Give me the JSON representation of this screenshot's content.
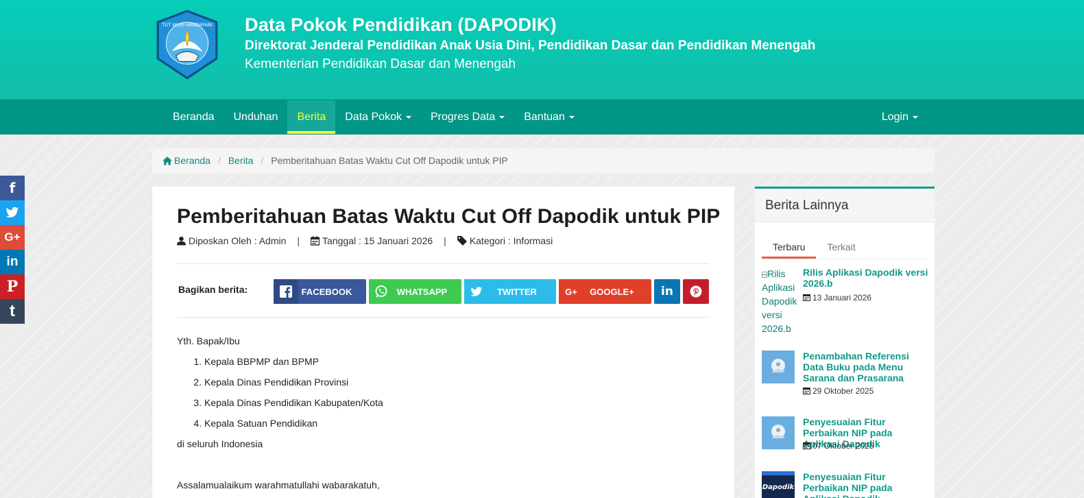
{
  "header": {
    "title": "Data Pokok Pendidikan (DAPODIK)",
    "subtitle": "Direktorat Jenderal Pendidikan Anak Usia Dini, Pendidikan Dasar dan Pendidikan Menengah",
    "ministry": "Kementerian Pendidikan Dasar dan Menengah",
    "logo_text": "TUT WURI HANDAYANI"
  },
  "nav": {
    "items": [
      {
        "label": "Beranda"
      },
      {
        "label": "Unduhan"
      },
      {
        "label": "Berita"
      },
      {
        "label": "Data Pokok"
      },
      {
        "label": "Progres Data"
      },
      {
        "label": "Bantuan"
      }
    ],
    "login": "Login"
  },
  "breadcrumb": {
    "home": "Beranda",
    "section": "Berita",
    "current": "Pemberitahuan Batas Waktu Cut Off Dapodik untuk PIP"
  },
  "article": {
    "title": "Pemberitahuan Batas Waktu Cut Off Dapodik untuk PIP",
    "author": "Diposkan Oleh : Admin",
    "date": "Tanggal : 15 Januari 2026",
    "category": "Kategori : Informasi",
    "share_label": "Bagikan berita:",
    "share": {
      "facebook": "FACEBOOK",
      "whatsapp": "WHATSAPP",
      "twitter": "TWITTER",
      "google": "GOOGLE+"
    },
    "greeting": "Yth. Bapak/Ibu",
    "recipients": [
      "Kepala BBPMP dan BPMP",
      "Kepala Dinas Pendidikan Provinsi",
      "Kepala Dinas Pendidikan Kabupaten/Kota",
      "Kepala Satuan Pendidikan"
    ],
    "location": "di seluruh Indonesia",
    "salam": "Assalamualaikum warahmatullahi wabarakatuh,"
  },
  "sidebar": {
    "heading": "Berita Lainnya",
    "tabs": [
      "Terbaru",
      "Terkait"
    ],
    "news": [
      {
        "title": "Rilis Aplikasi Dapodik versi 2026.b",
        "date": "13 Januari 2026",
        "thumb_alt": "Rilis Aplikasi Dapodik versi 2026.b"
      },
      {
        "title": "Penambahan Referensi Data Buku pada Menu Sarana dan Prasarana",
        "date": "29 Oktober 2025"
      },
      {
        "title": "Penyesuaian Fitur Perbaikan NIP pada Aplikasi Dapodik",
        "date": "07 Oktober 2025"
      },
      {
        "title": "Penyesuaian Fitur Perbaikan NIP pada Aplikasi Dapodik",
        "thumb_text": "Dapodik"
      }
    ]
  },
  "social": [
    "f",
    "t",
    "G+",
    "in",
    "P",
    "t"
  ],
  "colors": {
    "header": "#05cdb9",
    "navbar": "#019686",
    "active_nav": "#f4ff3b",
    "link": "#0f9a8a"
  }
}
